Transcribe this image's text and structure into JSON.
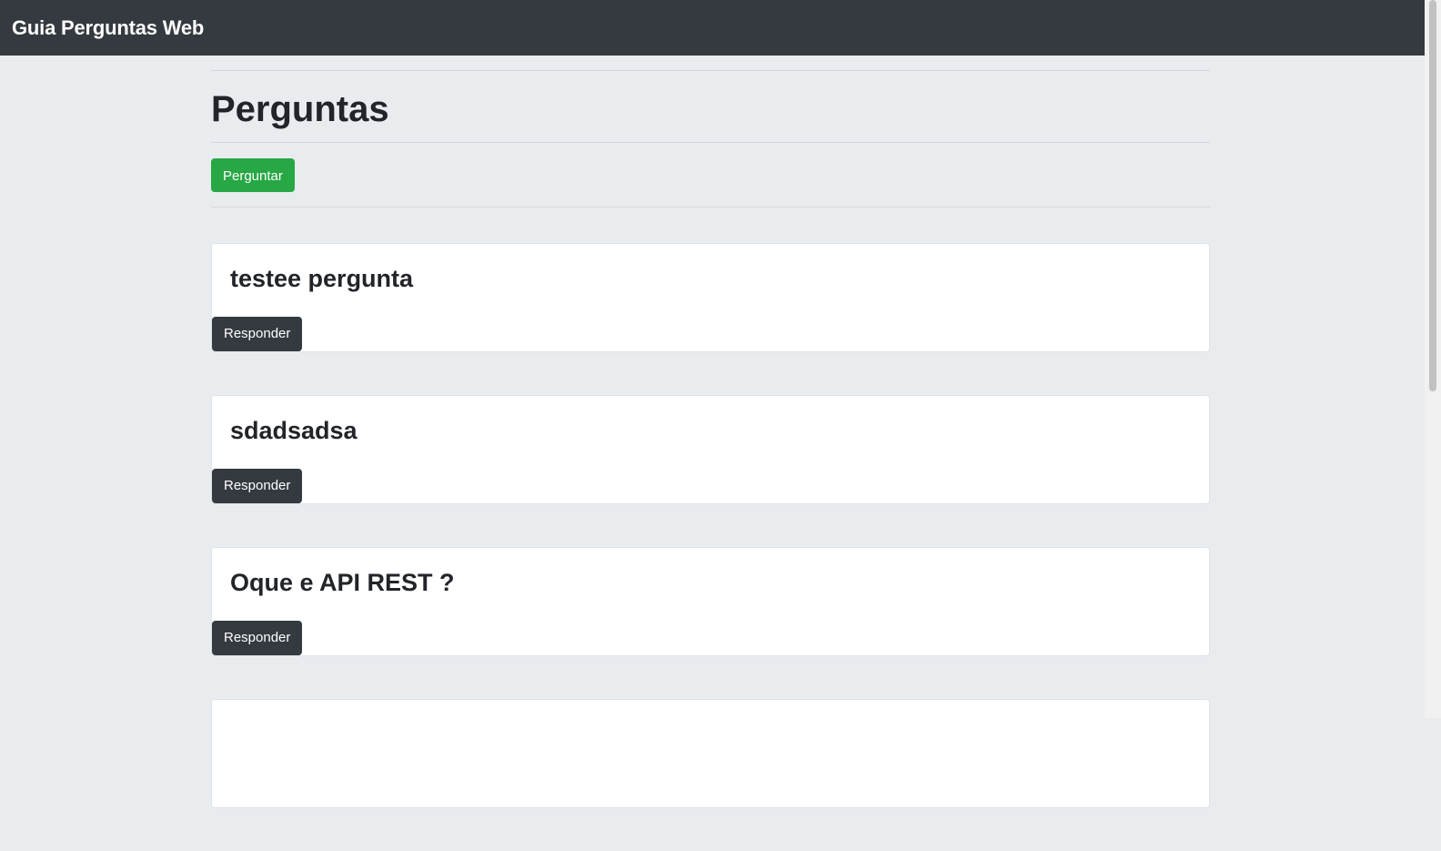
{
  "navbar": {
    "brand": "Guia Perguntas Web"
  },
  "page": {
    "title": "Perguntas",
    "ask_button": "Perguntar"
  },
  "questions": [
    {
      "title": "testee pergunta",
      "answer_button": "Responder"
    },
    {
      "title": "sdadsadsa",
      "answer_button": "Responder"
    },
    {
      "title": "Oque e API REST ?",
      "answer_button": "Responder"
    },
    {
      "title": "",
      "answer_button": ""
    }
  ],
  "colors": {
    "navbar_bg": "#343a40",
    "page_bg": "#e9ecef",
    "success": "#28a745",
    "dark": "#343a40"
  }
}
